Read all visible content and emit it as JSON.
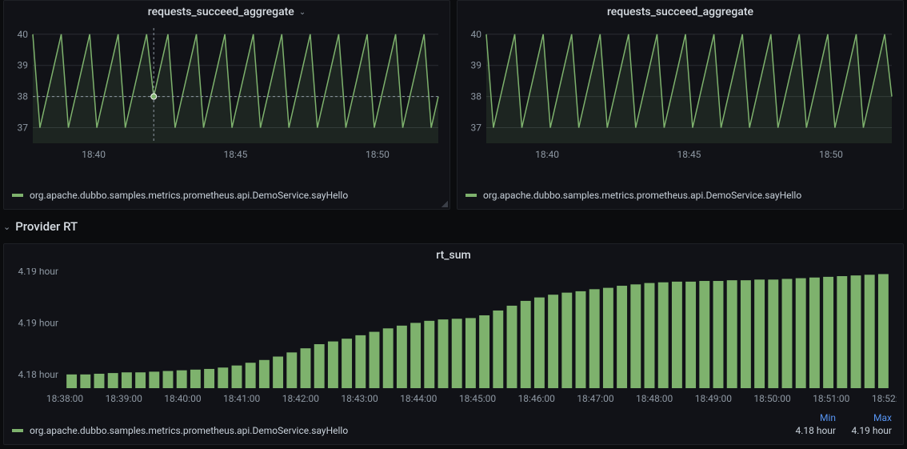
{
  "top_row": {
    "left": {
      "title": "requests_succeed_aggregate",
      "has_menu": true,
      "legend": "org.apache.dubbo.samples.metrics.prometheus.api.DemoService.sayHello",
      "hover": {
        "x_index": 17,
        "y_value": 38
      }
    },
    "right": {
      "title": "requests_succeed_aggregate",
      "has_menu": false,
      "legend": "org.apache.dubbo.samples.metrics.prometheus.api.DemoService.sayHello"
    },
    "y_ticks": [
      "37",
      "38",
      "39",
      "40"
    ],
    "x_ticks": [
      "18:40",
      "18:45",
      "18:50"
    ]
  },
  "section": {
    "title": "Provider RT"
  },
  "bottom": {
    "title": "rt_sum",
    "y_ticks": [
      "4.18 hour",
      "4.19 hour",
      "4.19 hour"
    ],
    "x_ticks": [
      "18:38:00",
      "18:39:00",
      "18:40:00",
      "18:41:00",
      "18:42:00",
      "18:43:00",
      "18:44:00",
      "18:45:00",
      "18:46:00",
      "18:47:00",
      "18:48:00",
      "18:49:00",
      "18:50:00",
      "18:51:00",
      "18:52:00"
    ],
    "legend_name": "org.apache.dubbo.samples.metrics.prometheus.api.DemoService.sayHello",
    "headers": {
      "min": "Min",
      "max": "Max"
    },
    "stats": {
      "min": "4.18 hour",
      "max": "4.19 hour"
    }
  },
  "chart_data": [
    {
      "type": "line",
      "title": "requests_succeed_aggregate",
      "xlabel": "",
      "ylabel": "",
      "ylim": [
        36.5,
        40.2
      ],
      "x_ticks": [
        "18:40",
        "18:45",
        "18:50"
      ],
      "series": [
        {
          "name": "org.apache.dubbo.samples.metrics.prometheus.api.DemoService.sayHello",
          "values": [
            40,
            37,
            38,
            39,
            40,
            37,
            38,
            39,
            40,
            37,
            38,
            39,
            40,
            37,
            38,
            39,
            40,
            38,
            39,
            40,
            37,
            38,
            39,
            40,
            37,
            38,
            39,
            40,
            37,
            38,
            39,
            40,
            37,
            38,
            39,
            40,
            37,
            38,
            39,
            40,
            37,
            38,
            39,
            40,
            37,
            38,
            39,
            40,
            37,
            38,
            39,
            40,
            37,
            38,
            39,
            40,
            37,
            38
          ]
        }
      ],
      "crosshair_value": 38
    },
    {
      "type": "line",
      "title": "requests_succeed_aggregate",
      "xlabel": "",
      "ylabel": "",
      "ylim": [
        36.5,
        40.2
      ],
      "x_ticks": [
        "18:40",
        "18:45",
        "18:50"
      ],
      "series": [
        {
          "name": "org.apache.dubbo.samples.metrics.prometheus.api.DemoService.sayHello",
          "values": [
            40,
            37,
            38,
            39,
            40,
            37,
            38,
            39,
            40,
            37,
            38,
            39,
            40,
            37,
            38,
            39,
            40,
            37,
            38,
            39,
            40,
            37,
            38,
            39,
            40,
            37,
            38,
            39,
            40,
            37,
            38,
            39,
            40,
            37,
            38,
            39,
            40,
            37,
            38,
            39,
            40,
            37,
            38,
            39,
            40,
            37,
            38,
            39,
            40,
            37,
            38,
            39,
            40,
            37,
            38,
            39,
            40,
            38
          ]
        }
      ]
    },
    {
      "type": "bar",
      "title": "rt_sum",
      "xlabel": "",
      "ylabel": "hour",
      "ylim": [
        4.178,
        4.195
      ],
      "x_ticks": [
        "18:38:00",
        "18:39:00",
        "18:40:00",
        "18:41:00",
        "18:42:00",
        "18:43:00",
        "18:44:00",
        "18:45:00",
        "18:46:00",
        "18:47:00",
        "18:48:00",
        "18:49:00",
        "18:50:00",
        "18:51:00",
        "18:52:00"
      ],
      "series": [
        {
          "name": "org.apache.dubbo.samples.metrics.prometheus.api.DemoService.sayHello",
          "values": [
            4.18,
            4.18,
            4.1801,
            4.1802,
            4.1803,
            4.1803,
            4.1804,
            4.1805,
            4.1806,
            4.1807,
            4.1808,
            4.181,
            4.1813,
            4.1817,
            4.1821,
            4.1826,
            4.1832,
            4.1838,
            4.1844,
            4.1848,
            4.1852,
            4.1857,
            4.1862,
            4.1867,
            4.1871,
            4.1875,
            4.1878,
            4.188,
            4.1881,
            4.1882,
            4.1886,
            4.1893,
            4.19,
            4.1907,
            4.1912,
            4.1916,
            4.1919,
            4.1921,
            4.1924,
            4.1926,
            4.1929,
            4.1931,
            4.1933,
            4.1934,
            4.1935,
            4.1935,
            4.1936,
            4.1936,
            4.1937,
            4.1937,
            4.1938,
            4.1938,
            4.1939,
            4.194,
            4.1941,
            4.1942,
            4.1943,
            4.1944,
            4.1945,
            4.1946
          ]
        }
      ],
      "stats": {
        "min": "4.18 hour",
        "max": "4.19 hour"
      }
    }
  ]
}
